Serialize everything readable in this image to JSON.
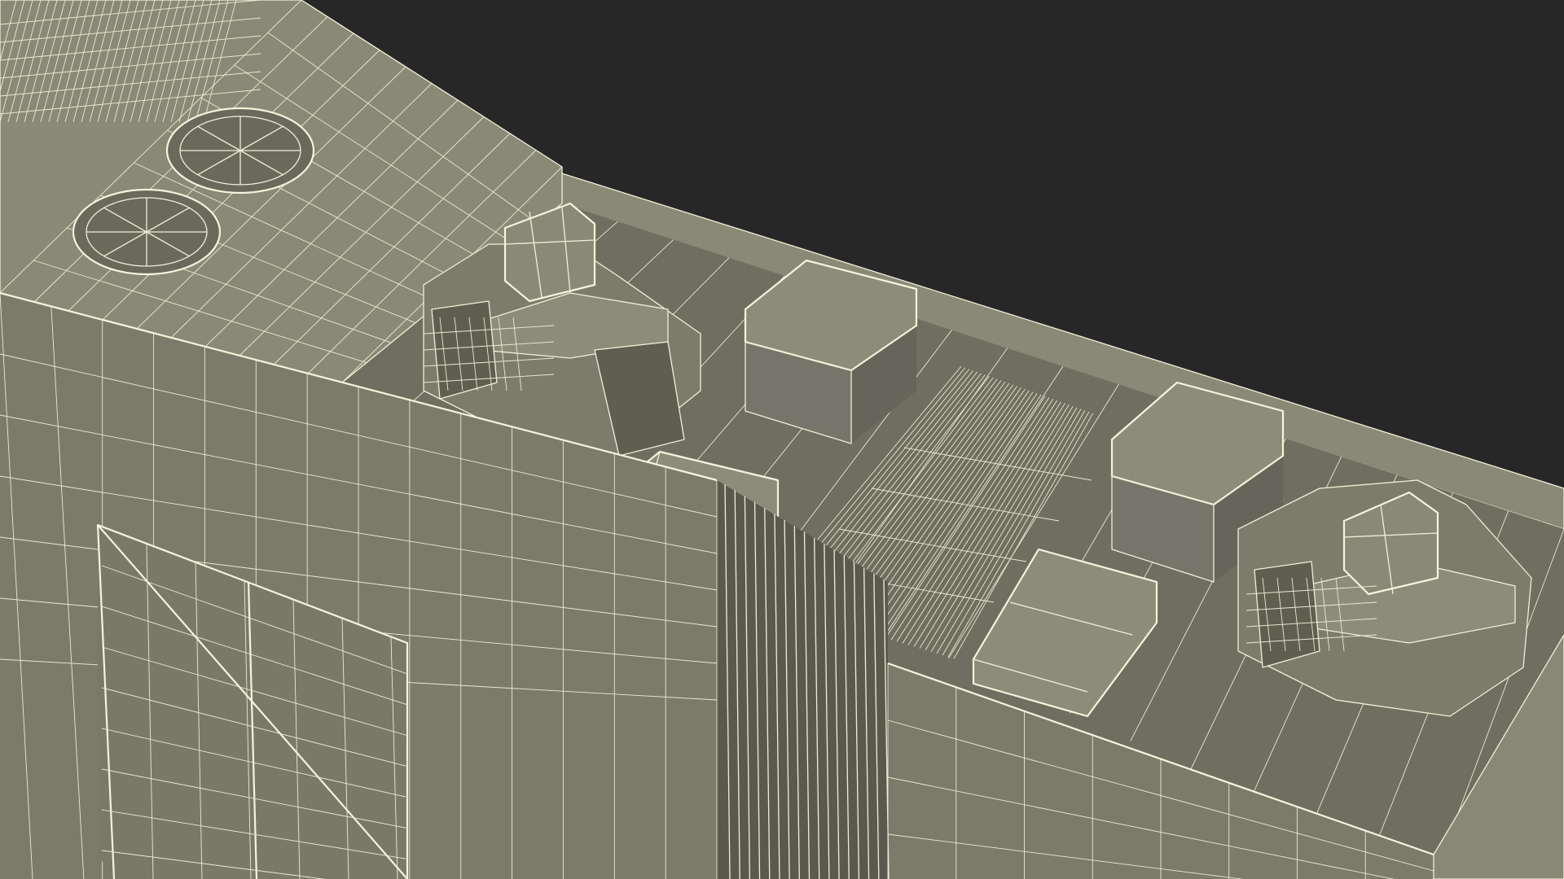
{
  "scene": {
    "subject": "wireframe-3d-model-render",
    "colors": {
      "background": "#272727",
      "surface": "#7c7b6b",
      "surface_light": "#8d8c7b",
      "surface_dark": "#5f5e51",
      "surface_shadow": "#4d4c42",
      "wire": "#f2efd6"
    }
  }
}
